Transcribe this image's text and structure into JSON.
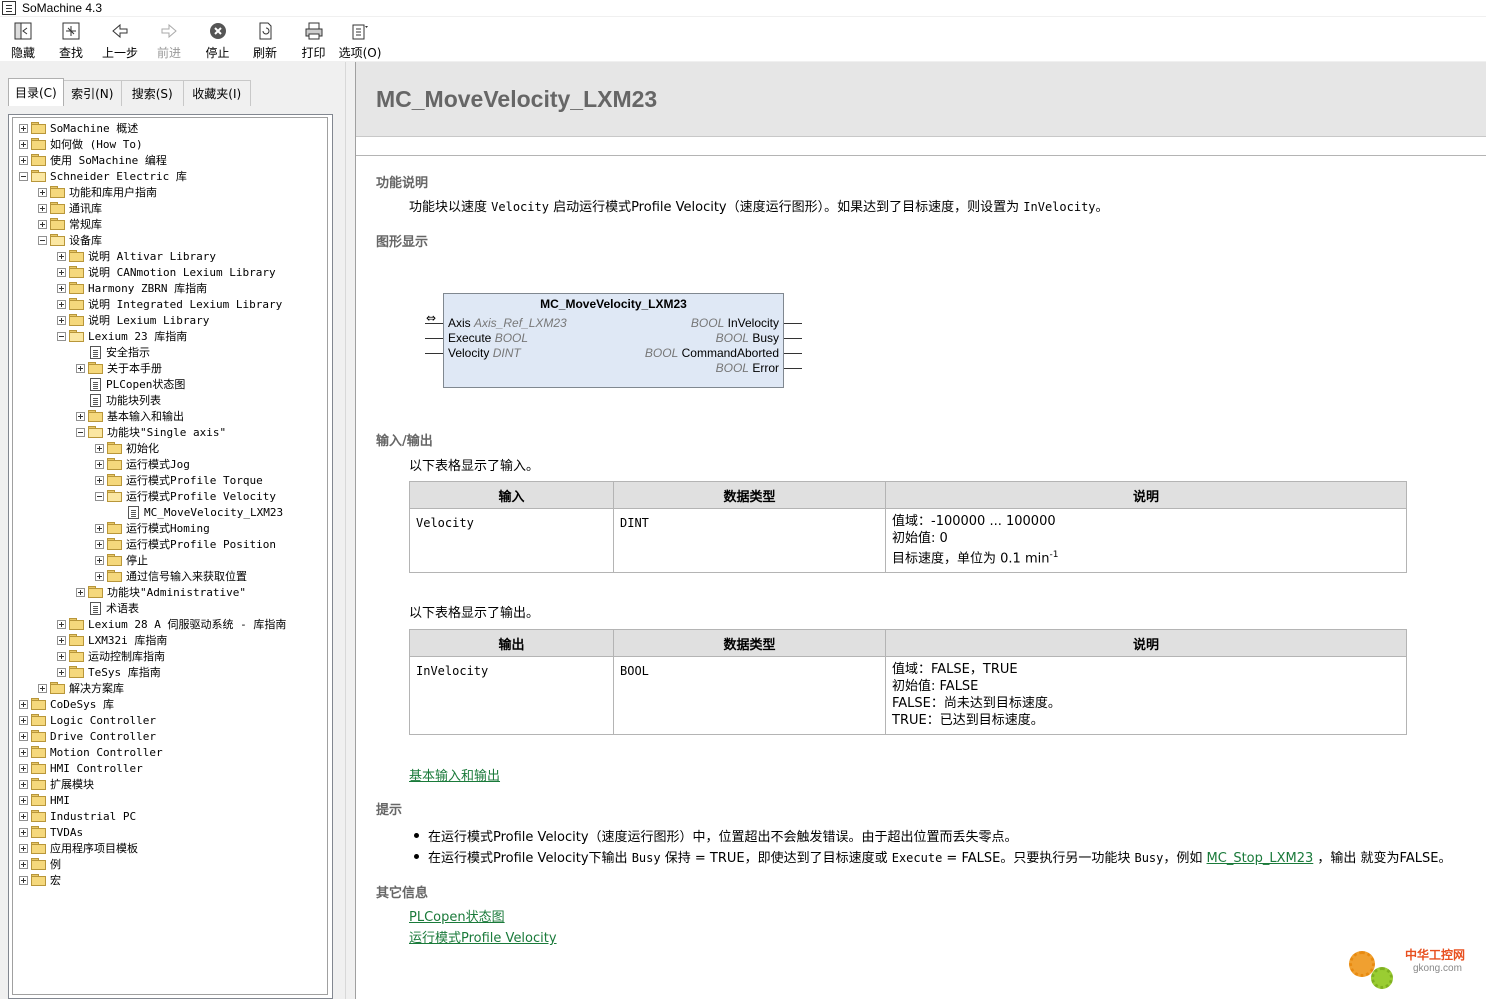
{
  "window": {
    "title": "SoMachine 4.3"
  },
  "toolbar": {
    "buttons": [
      {
        "label": "隐藏",
        "icon": "hide-icon"
      },
      {
        "label": "查找",
        "icon": "locate-icon"
      },
      {
        "label": "上一步",
        "icon": "back-arrow-icon"
      },
      {
        "label": "前进",
        "icon": "forward-arrow-icon"
      },
      {
        "label": "停止",
        "icon": "stop-icon"
      },
      {
        "label": "刷新",
        "icon": "refresh-icon"
      },
      {
        "label": "打印",
        "icon": "print-icon"
      },
      {
        "label": "选项(O)",
        "icon": "options-icon"
      }
    ]
  },
  "nav_tabs": [
    {
      "label": "目录(C)"
    },
    {
      "label": "索引(N)"
    },
    {
      "label": "搜索(S)"
    },
    {
      "label": "收藏夹(I)"
    }
  ],
  "tree": [
    {
      "label": "SoMachine 概述",
      "level": 0,
      "type": "folder",
      "state": "closed"
    },
    {
      "label": "如何做 (How To)",
      "level": 0,
      "type": "folder",
      "state": "closed"
    },
    {
      "label": "使用 SoMachine 编程",
      "level": 0,
      "type": "folder",
      "state": "closed"
    },
    {
      "label": "Schneider Electric 库",
      "level": 0,
      "type": "folder",
      "state": "open"
    },
    {
      "label": "功能和库用户指南",
      "level": 1,
      "type": "folder",
      "state": "closed"
    },
    {
      "label": "通讯库",
      "level": 1,
      "type": "folder",
      "state": "closed"
    },
    {
      "label": "常规库",
      "level": 1,
      "type": "folder",
      "state": "closed"
    },
    {
      "label": "设备库",
      "level": 1,
      "type": "folder",
      "state": "open"
    },
    {
      "label": "说明 Altivar Library",
      "level": 2,
      "type": "folder",
      "state": "closed"
    },
    {
      "label": "说明 CANmotion Lexium Library",
      "level": 2,
      "type": "folder",
      "state": "closed"
    },
    {
      "label": "Harmony ZBRN 库指南",
      "level": 2,
      "type": "folder",
      "state": "closed"
    },
    {
      "label": "说明 Integrated Lexium Library",
      "level": 2,
      "type": "folder",
      "state": "closed"
    },
    {
      "label": "说明 Lexium Library",
      "level": 2,
      "type": "folder",
      "state": "closed"
    },
    {
      "label": "Lexium 23 库指南",
      "level": 2,
      "type": "folder",
      "state": "open"
    },
    {
      "label": "安全指示",
      "level": 3,
      "type": "page"
    },
    {
      "label": "关于本手册",
      "level": 3,
      "type": "folder",
      "state": "closed"
    },
    {
      "label": "PLCopen状态图",
      "level": 3,
      "type": "page"
    },
    {
      "label": "功能块列表",
      "level": 3,
      "type": "page"
    },
    {
      "label": "基本输入和输出",
      "level": 3,
      "type": "folder",
      "state": "closed"
    },
    {
      "label": "功能块\"Single axis\"",
      "level": 3,
      "type": "folder",
      "state": "open"
    },
    {
      "label": "初始化",
      "level": 4,
      "type": "folder",
      "state": "closed"
    },
    {
      "label": "运行模式Jog",
      "level": 4,
      "type": "folder",
      "state": "closed"
    },
    {
      "label": "运行模式Profile Torque",
      "level": 4,
      "type": "folder",
      "state": "closed"
    },
    {
      "label": "运行模式Profile Velocity",
      "level": 4,
      "type": "folder",
      "state": "open"
    },
    {
      "label": "MC_MoveVelocity_LXM23",
      "level": 5,
      "type": "page"
    },
    {
      "label": "运行模式Homing",
      "level": 4,
      "type": "folder",
      "state": "closed"
    },
    {
      "label": "运行模式Profile Position",
      "level": 4,
      "type": "folder",
      "state": "closed"
    },
    {
      "label": "停止",
      "level": 4,
      "type": "folder",
      "state": "closed"
    },
    {
      "label": "通过信号输入来获取位置",
      "level": 4,
      "type": "folder",
      "state": "closed"
    },
    {
      "label": "功能块\"Administrative\"",
      "level": 3,
      "type": "folder",
      "state": "closed"
    },
    {
      "label": "术语表",
      "level": 3,
      "type": "page"
    },
    {
      "label": "Lexium 28 A 伺服驱动系统 - 库指南",
      "level": 2,
      "type": "folder",
      "state": "closed"
    },
    {
      "label": "LXM32i 库指南",
      "level": 2,
      "type": "folder",
      "state": "closed"
    },
    {
      "label": "运动控制库指南",
      "level": 2,
      "type": "folder",
      "state": "closed"
    },
    {
      "label": "TeSys 库指南",
      "level": 2,
      "type": "folder",
      "state": "closed"
    },
    {
      "label": "解决方案库",
      "level": 1,
      "type": "folder",
      "state": "closed"
    },
    {
      "label": "CoDeSys 库",
      "level": 0,
      "type": "folder",
      "state": "closed"
    },
    {
      "label": "Logic Controller",
      "level": 0,
      "type": "folder",
      "state": "closed"
    },
    {
      "label": "Drive Controller",
      "level": 0,
      "type": "folder",
      "state": "closed"
    },
    {
      "label": "Motion Controller",
      "level": 0,
      "type": "folder",
      "state": "closed"
    },
    {
      "label": "HMI Controller",
      "level": 0,
      "type": "folder",
      "state": "closed"
    },
    {
      "label": "扩展模块",
      "level": 0,
      "type": "folder",
      "state": "closed"
    },
    {
      "label": "HMI",
      "level": 0,
      "type": "folder",
      "state": "closed"
    },
    {
      "label": "Industrial PC",
      "level": 0,
      "type": "folder",
      "state": "closed"
    },
    {
      "label": "TVDAs",
      "level": 0,
      "type": "folder",
      "state": "closed"
    },
    {
      "label": "应用程序项目模板",
      "level": 0,
      "type": "folder",
      "state": "closed"
    },
    {
      "label": "例",
      "level": 0,
      "type": "folder",
      "state": "closed"
    },
    {
      "label": "宏",
      "level": 0,
      "type": "folder",
      "state": "closed"
    }
  ],
  "content": {
    "title": "MC_MoveVelocity_LXM23",
    "func_title": "功能说明",
    "func_desc": {
      "p1": "功能块以速度 ",
      "c1": "Velocity",
      "p2": " 启动运行模式Profile Velocity（速度运行图形）。如果达到了目标速度，则设置为 ",
      "c2": "InVelocity",
      "p3": "。"
    },
    "graphic_title": "图形显示",
    "fb": {
      "name": "MC_MoveVelocity_LXM23",
      "in_axis_name": "Axis",
      "in_axis_type": "Axis_Ref_LXM23",
      "in_exec_name": "Execute",
      "in_exec_type": "BOOL",
      "in_vel_name": "Velocity",
      "in_vel_type": "DINT",
      "out_invel_type": "BOOL",
      "out_invel_name": "InVelocity",
      "out_busy_type": "BOOL",
      "out_busy_name": "Busy",
      "out_abort_type": "BOOL",
      "out_abort_name": "CommandAborted",
      "out_err_type": "BOOL",
      "out_err_name": "Error",
      "inout_arrow": "⇔"
    },
    "io_title": "输入/输出",
    "inputs_intro": "以下表格显示了输入。",
    "inputs_table": {
      "headers": [
        "输入",
        "数据类型",
        "说明"
      ],
      "row": {
        "name": "Velocity",
        "type": "DINT",
        "desc1": "值域：-100000 ... 100000",
        "desc2": "初始值: 0",
        "desc3": "目标速度，单位为  0.1 min",
        "desc3_sup": "-1"
      }
    },
    "outputs_intro": "以下表格显示了输出。",
    "outputs_table": {
      "headers": [
        "输出",
        "数据类型",
        "说明"
      ],
      "row": {
        "name": "InVelocity",
        "type": "BOOL",
        "desc1": "值域：FALSE，TRUE",
        "desc2": "初始值: FALSE",
        "desc3": "FALSE：尚未达到目标速度。",
        "desc4": "TRUE：已达到目标速度。"
      }
    },
    "basic_io_link": "基本输入和输出",
    "tips_title": "提示",
    "tip1": "在运行模式Profile Velocity（速度运行图形）中，位置超出不会触发错误。由于超出位置而丢失零点。",
    "tip2": {
      "p1": "在运行模式Profile Velocity下输出 ",
      "c1": "Busy",
      "p2": " 保持 = TRUE，即使达到了目标速度或 ",
      "c2": "Execute",
      "p3": " = FALSE。只要执行另一功能块 ",
      "c3": "Busy",
      "p4": "，例如 ",
      "link": "MC_Stop_LXM23",
      "p5": " ，输出 就变为FALSE。"
    },
    "other_title": "其它信息",
    "other_links": [
      "PLCopen状态图",
      "运行模式Profile Velocity"
    ]
  },
  "watermark": {
    "text": "中华工控网",
    "url": "gkong.com"
  }
}
